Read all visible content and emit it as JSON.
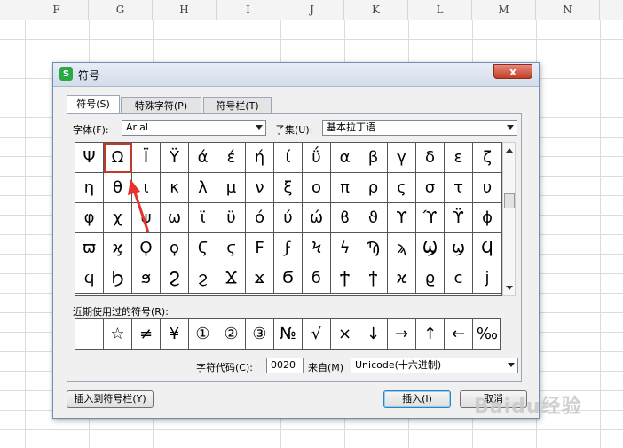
{
  "sheet": {
    "columns": [
      "F",
      "G",
      "H",
      "I",
      "J",
      "K",
      "L",
      "M",
      "N"
    ]
  },
  "dialog": {
    "title": "符号",
    "app_icon": "S",
    "close_label": "x",
    "tabs": [
      {
        "label": "符号(S)",
        "active": true
      },
      {
        "label": "特殊字符(P)",
        "active": false
      },
      {
        "label": "符号栏(T)",
        "active": false
      }
    ],
    "font_label": "字体(F):",
    "font_value": "Arial",
    "subset_label": "子集(U):",
    "subset_value": "基本拉丁语",
    "symbols": [
      [
        "Ψ",
        "Ω",
        "Ï",
        "Ÿ",
        "ά",
        "έ",
        "ή",
        "ί",
        "ΰ",
        "α",
        "β",
        "γ",
        "δ",
        "ε",
        "ζ"
      ],
      [
        "η",
        "θ",
        "ι",
        "κ",
        "λ",
        "μ",
        "ν",
        "ξ",
        "ο",
        "π",
        "ρ",
        "ς",
        "σ",
        "τ",
        "υ"
      ],
      [
        "φ",
        "χ",
        "ψ",
        "ω",
        "ϊ",
        "ϋ",
        "ό",
        "ύ",
        "ώ",
        "ϐ",
        "ϑ",
        "ϒ",
        "ϓ",
        "ϔ",
        "ϕ"
      ],
      [
        "ϖ",
        "ϗ",
        "Ϙ",
        "ϙ",
        "Ϛ",
        "ϛ",
        "Ϝ",
        "ϝ",
        "Ϟ",
        "ϟ",
        "Ϡ",
        "ϡ",
        "Ϣ",
        "ϣ",
        "Ϥ"
      ],
      [
        "ϥ",
        "Ϧ",
        "ϧ",
        "Ϩ",
        "ϩ",
        "Ϫ",
        "ϫ",
        "Ϭ",
        "ϭ",
        "Ϯ",
        "ϯ",
        "ϰ",
        "ϱ",
        "ϲ",
        "ϳ"
      ]
    ],
    "selected_symbol": "Ω",
    "recent_label": "近期使用过的符号(R):",
    "recent_symbols": [
      "",
      "☆",
      "≠",
      "¥",
      "①",
      "②",
      "③",
      "№",
      "√",
      "×",
      "↓",
      "→",
      "↑",
      "←",
      "‰"
    ],
    "char_code_label": "字符代码(C):",
    "char_code_value": "0020",
    "from_label": "来自(M)",
    "from_value": "Unicode(十六进制)",
    "insert_to_bar_label": "插入到符号栏(Y)",
    "insert_label": "插入(I)",
    "cancel_label": "取消"
  },
  "watermark": "Baidu经验",
  "colors": {
    "selection_border": "#c0392b",
    "annotation_arrow": "#e8312a",
    "app_icon": "#2aa845"
  }
}
